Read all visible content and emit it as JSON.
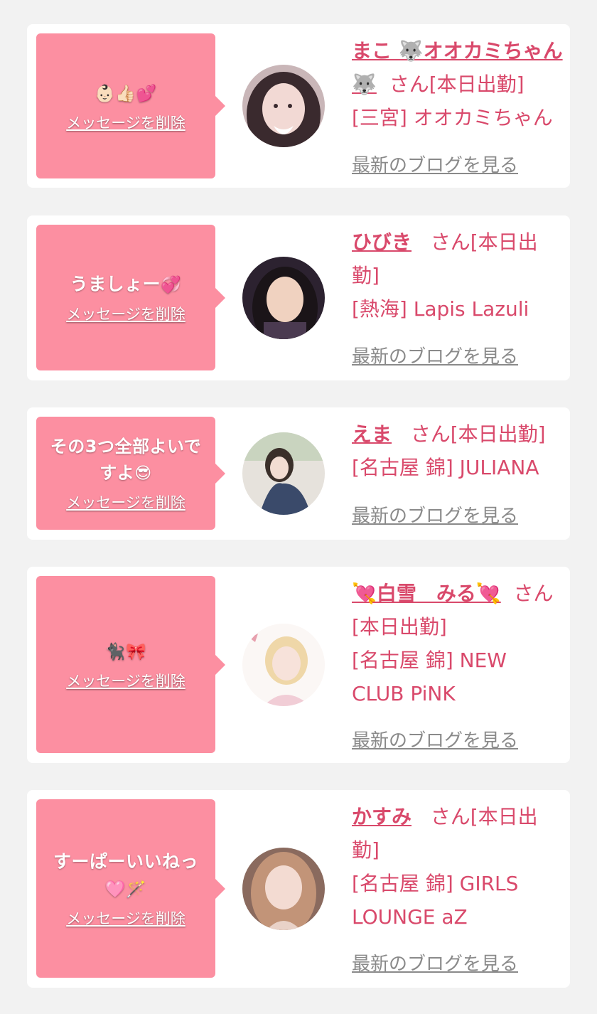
{
  "delete_label": "メッセージを削除",
  "blog_label": "最新のブログを見る",
  "colors": {
    "page_bg": "#f2f2f2",
    "card_bg": "#ffffff",
    "bubble_bg": "#fc8fa1",
    "accent": "#d9496b",
    "link_gray": "#8a8a8a"
  },
  "entries": [
    {
      "message_emojis": "👶🏻👍🏻💕",
      "name": "まこ 🐺オオカミちゃん🐺",
      "suffix": "さん[本日出勤]",
      "location": "[三宮] オオカミちゃん",
      "avatar_icon": "portrait-avatar"
    },
    {
      "message": "うましょー",
      "message_emojis": "💞",
      "name": "ひびき",
      "suffix": "さん[本日出勤]",
      "location": "[熱海] Lapis Lazuli",
      "avatar_icon": "portrait-avatar"
    },
    {
      "message": "その3つ全部よいですよ",
      "message_emojis": "😎",
      "name": "えま",
      "suffix": "さん[本日出勤]",
      "location": "[名古屋 錦] JULIANA",
      "avatar_icon": "portrait-avatar"
    },
    {
      "message_emojis": "🐈‍⬛🎀",
      "name": "💘白雪　みる💘",
      "suffix": "さん[本日出勤]",
      "location": "[名古屋 錦] NEW CLUB PiNK",
      "avatar_icon": "portrait-avatar"
    },
    {
      "message": "すーぱーいいねっ",
      "message_emojis": "🩷🪄",
      "name": "かすみ",
      "suffix": "さん[本日出勤]",
      "location": "[名古屋 錦] GIRLS LOUNGE aZ",
      "avatar_icon": "portrait-avatar"
    }
  ]
}
